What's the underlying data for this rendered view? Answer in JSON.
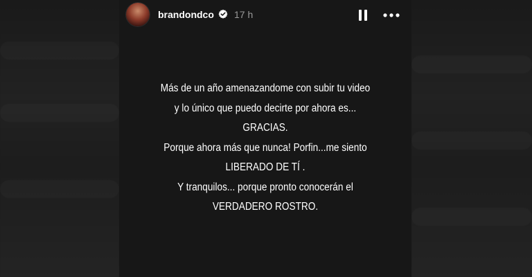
{
  "story": {
    "username": "brandondco",
    "time": "17 h",
    "icons": {
      "avatar": "profile-avatar",
      "verified": "verified-badge-icon",
      "pause": "pause-icon",
      "more": "more-options-icon"
    },
    "lines": [
      "Más de un año amenazandome con subir tu video",
      "y lo único que puedo decirte por ahora es...",
      "GRACIAS.",
      "Porque ahora más que nunca! Porfin...me siento",
      "LIBERADO DE TÍ .",
      "Y tranquilos... porque pronto conocerán el",
      "VERDADERO ROSTRO."
    ]
  },
  "colors": {
    "background": "#1b1b1b",
    "story_background": "#171717",
    "text": "#ffffff",
    "timestamp": "#9a9a9a"
  }
}
